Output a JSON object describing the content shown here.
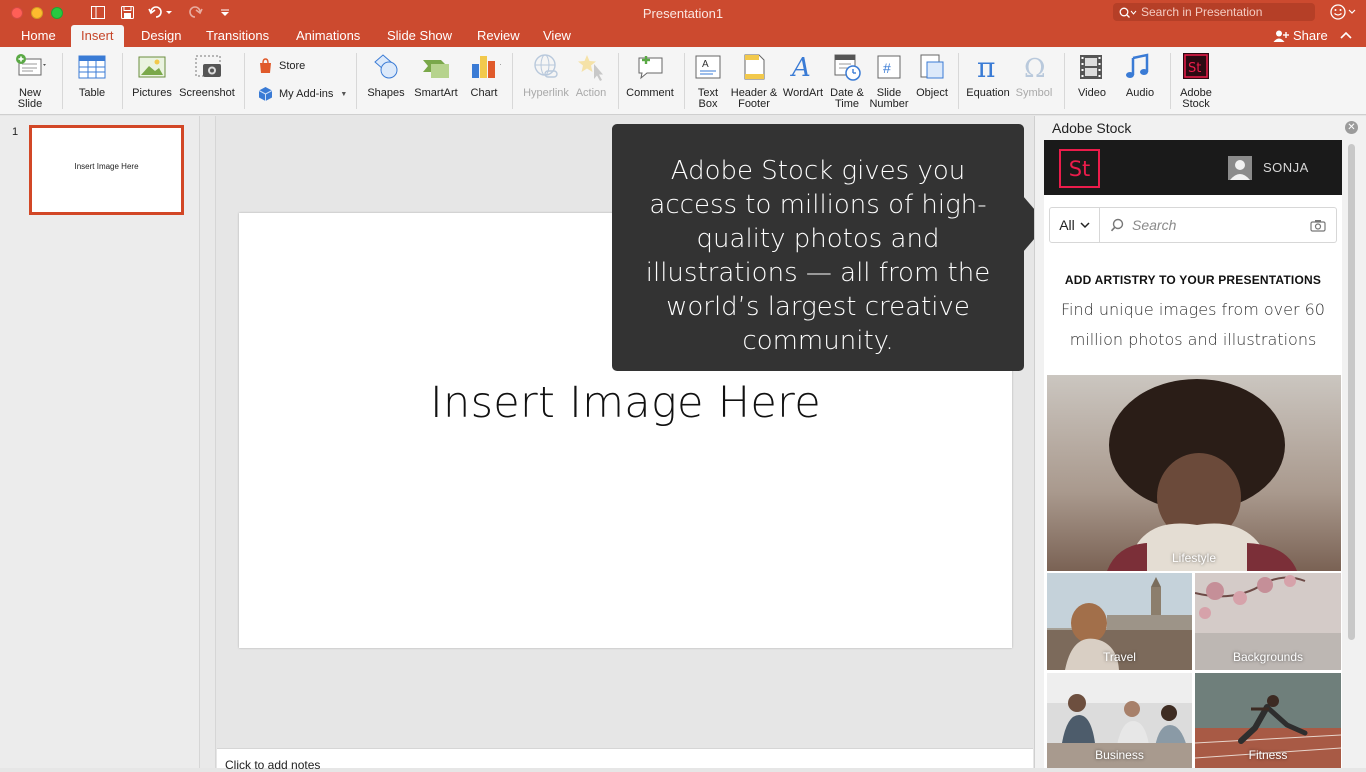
{
  "window": {
    "title": "Presentation1",
    "search_placeholder": "Search in Presentation"
  },
  "tabs": [
    {
      "label": "Home"
    },
    {
      "label": "Insert"
    },
    {
      "label": "Design"
    },
    {
      "label": "Transitions"
    },
    {
      "label": "Animations"
    },
    {
      "label": "Slide Show"
    },
    {
      "label": "Review"
    },
    {
      "label": "View"
    }
  ],
  "share_label": "Share",
  "ribbon": {
    "new_slide": "New Slide",
    "table": "Table",
    "pictures": "Pictures",
    "screenshot": "Screenshot",
    "store": "Store",
    "my_addins": "My Add-ins",
    "shapes": "Shapes",
    "smartart": "SmartArt",
    "chart": "Chart",
    "hyperlink": "Hyperlink",
    "action": "Action",
    "comment": "Comment",
    "text_box": "Text Box",
    "header_footer": "Header & Footer",
    "wordart": "WordArt",
    "date_time": "Date & Time",
    "slide_number": "Slide Number",
    "object": "Object",
    "equation": "Equation",
    "symbol": "Symbol",
    "video": "Video",
    "audio": "Audio",
    "adobe_stock": "Adobe Stock"
  },
  "thumbnails": [
    {
      "number": "1",
      "text": "Insert Image Here"
    }
  ],
  "slide": {
    "title": "Insert Image Here"
  },
  "notes_placeholder": "Click to add notes",
  "callout": {
    "text": "Adobe Stock gives you access to millions of high-quality photos and illustrations — all from the world’s largest creative community."
  },
  "stock_panel": {
    "title": "Adobe Stock",
    "logo": "St",
    "username": "SONJA",
    "filter": "All",
    "search_placeholder": "Search",
    "promo_heading": "ADD ARTISTRY TO YOUR PRESENTATIONS",
    "promo_text": "Find unique images from over 60 million photos and illustrations",
    "categories": [
      {
        "label": "Lifestyle"
      },
      {
        "label": "Travel"
      },
      {
        "label": "Backgrounds"
      },
      {
        "label": "Business"
      },
      {
        "label": "Fitness"
      }
    ]
  },
  "colors": {
    "accent": "#cc4a2f",
    "stock_brand": "#eb1c4b",
    "callout_bg": "#333333"
  }
}
